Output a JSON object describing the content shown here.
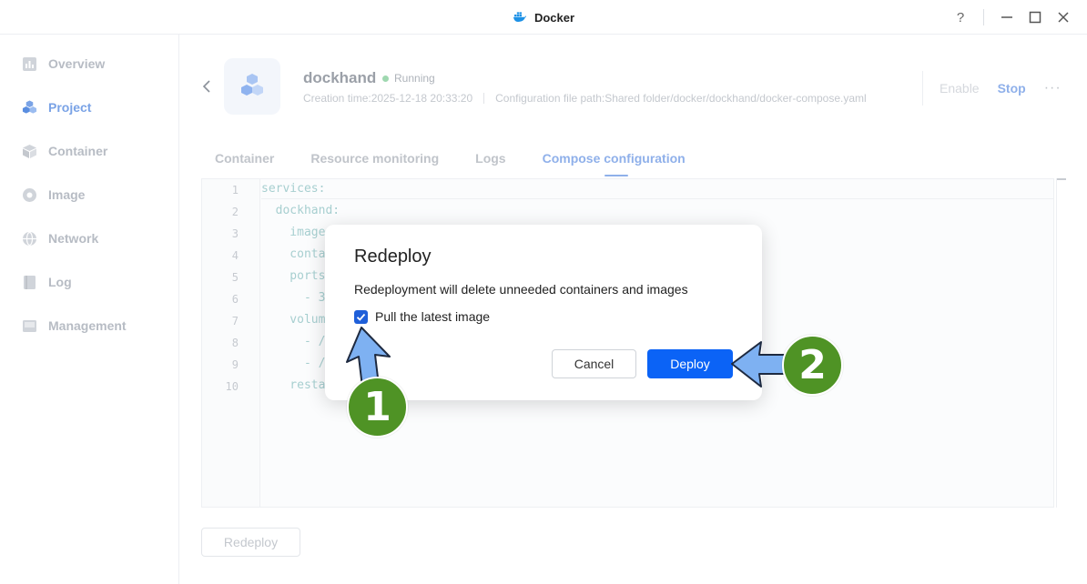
{
  "window": {
    "title": "Docker",
    "help": "?",
    "minimize": "—",
    "maximize": "☐",
    "close": "✕"
  },
  "sidebar": {
    "items": [
      {
        "label": "Overview",
        "icon": "overview-icon",
        "active": false
      },
      {
        "label": "Project",
        "icon": "project-icon",
        "active": true
      },
      {
        "label": "Container",
        "icon": "container-icon",
        "active": false
      },
      {
        "label": "Image",
        "icon": "image-icon",
        "active": false
      },
      {
        "label": "Network",
        "icon": "network-icon",
        "active": false
      },
      {
        "label": "Log",
        "icon": "log-icon",
        "active": false
      },
      {
        "label": "Management",
        "icon": "management-icon",
        "active": false
      }
    ]
  },
  "project": {
    "name": "dockhand",
    "status": "Running",
    "creation_time": "Creation time:2025-12-18 20:33:20",
    "config_path": "Configuration file path:Shared folder/docker/dockhand/docker-compose.yaml",
    "actions": {
      "enable": "Enable",
      "stop": "Stop",
      "more": "···"
    }
  },
  "tabs": [
    {
      "label": "Container",
      "active": false
    },
    {
      "label": "Resource monitoring",
      "active": false
    },
    {
      "label": "Logs",
      "active": false
    },
    {
      "label": "Compose configuration",
      "active": true
    }
  ],
  "editor": {
    "line_numbers": [
      "1",
      "2",
      "3",
      "4",
      "5",
      "6",
      "7",
      "8",
      "9",
      "10"
    ],
    "lines": [
      "services:",
      "  dockhand:",
      "    image",
      "    conta",
      "    ports",
      "      - 3",
      "    volume",
      "      - /",
      "      - /",
      "    resta"
    ]
  },
  "footer": {
    "redeploy_label": "Redeploy"
  },
  "modal": {
    "title": "Redeploy",
    "description": "Redeployment will delete unneeded containers and images",
    "checkbox_label": "Pull the latest image",
    "checkbox_checked": true,
    "cancel_label": "Cancel",
    "deploy_label": "Deploy"
  },
  "annotations": {
    "step1": "1",
    "step2": "2",
    "arrow_color": "#7eb1f2",
    "badge_color": "#4f9325"
  }
}
